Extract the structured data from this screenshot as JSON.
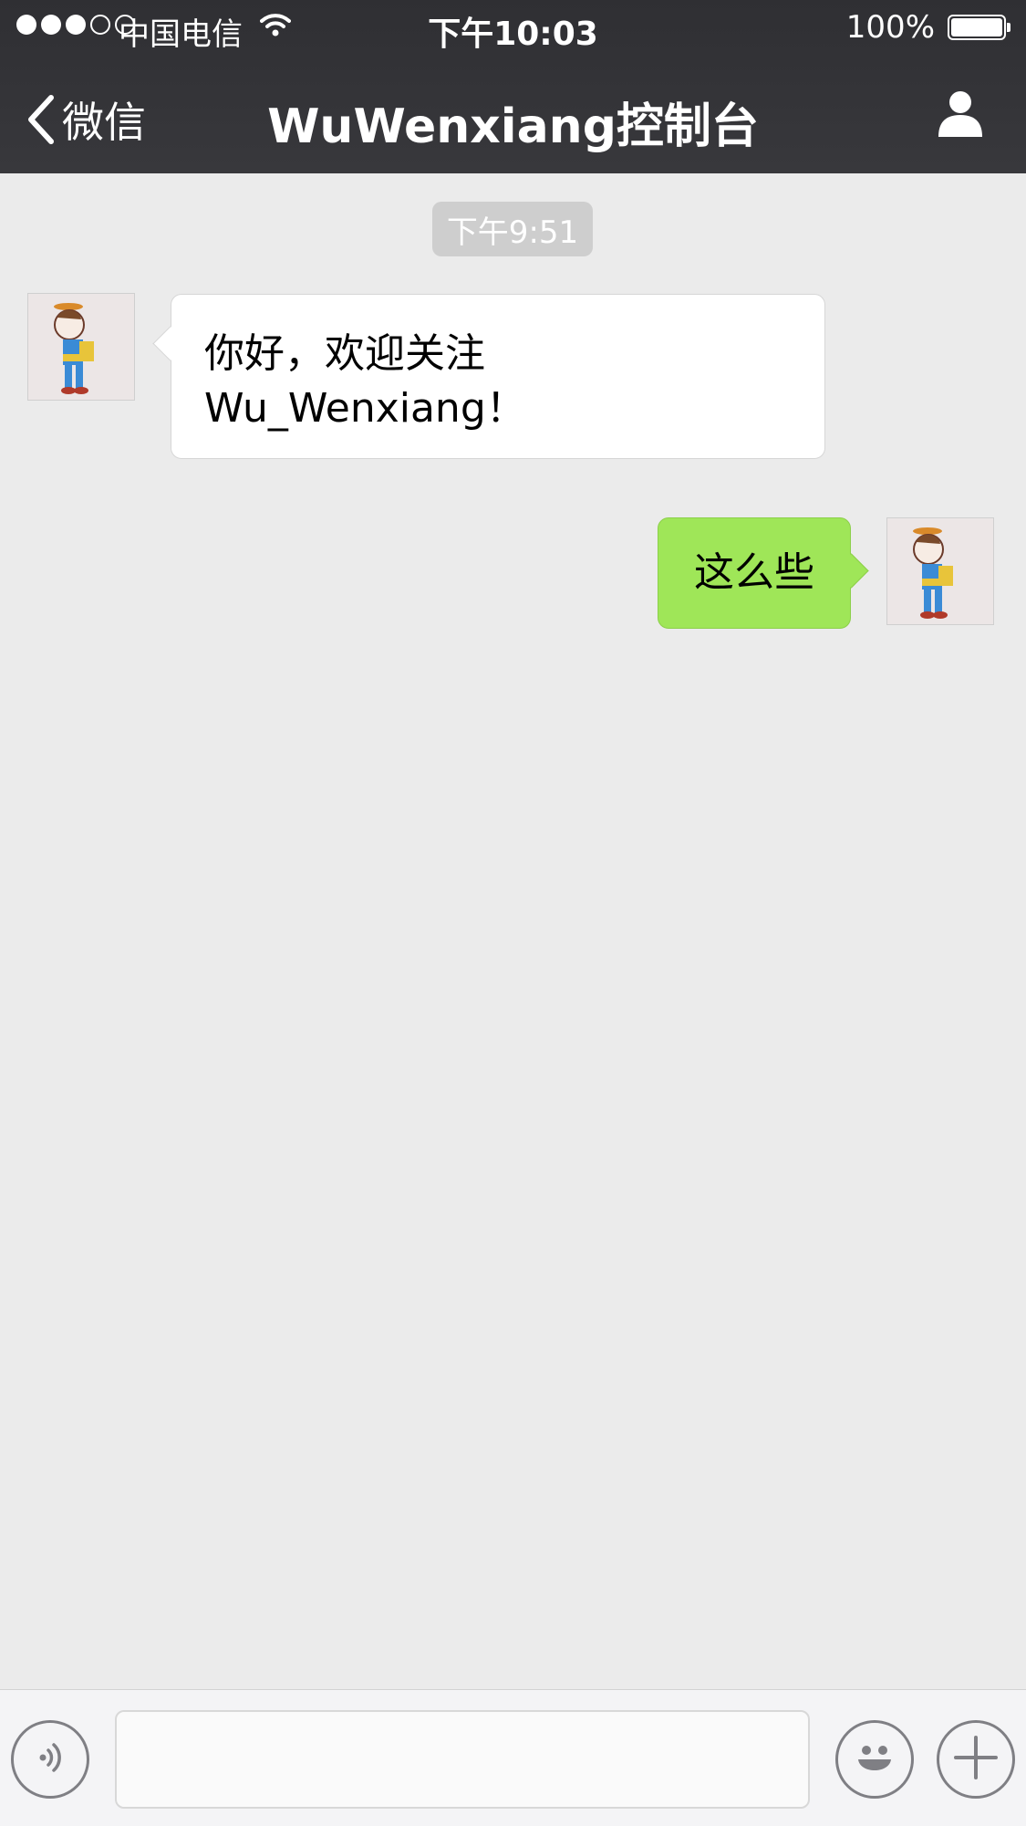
{
  "status_bar": {
    "carrier": "中国电信",
    "time": "下午10:03",
    "battery": "100%",
    "signal_strength": 3,
    "signal_max": 5
  },
  "nav": {
    "back_label": "微信",
    "title": "WuWenxiang控制台"
  },
  "chat": {
    "timestamp": "下午9:51",
    "messages": [
      {
        "sender": "other",
        "lines": [
          "你好，欢迎关注",
          "Wu_Wenxiang！"
        ]
      },
      {
        "sender": "me",
        "text": "这么些"
      }
    ]
  },
  "icons": {
    "back": "chevron-left-icon",
    "profile": "person-icon",
    "voice": "voice-icon",
    "emoji": "emoji-icon",
    "plus": "plus-icon",
    "wifi": "wifi-icon",
    "battery": "battery-icon"
  },
  "colors": {
    "header_bg": "#333337",
    "chat_bg": "#ebebeb",
    "outgoing_bubble": "#9fe658",
    "incoming_bubble": "#ffffff"
  }
}
